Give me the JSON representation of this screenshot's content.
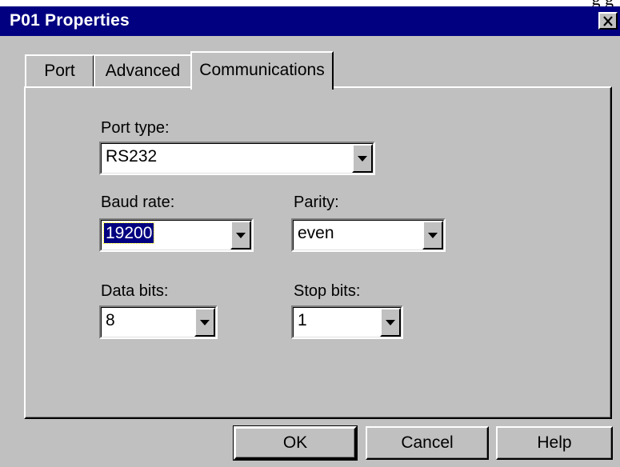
{
  "background_text": "g g",
  "window": {
    "title": "P01 Properties",
    "colors": {
      "titlebar": "#000080",
      "face": "#c0c0c0",
      "selection": "#000080"
    }
  },
  "tabs": [
    {
      "label": "Port",
      "active": false
    },
    {
      "label": "Advanced",
      "active": false
    },
    {
      "label": "Communications",
      "active": true
    }
  ],
  "communications": {
    "port_type": {
      "label": "Port type:",
      "value": "RS232"
    },
    "baud_rate": {
      "label": "Baud rate:",
      "value": "19200"
    },
    "parity": {
      "label": "Parity:",
      "value": "even"
    },
    "data_bits": {
      "label": "Data bits:",
      "value": "8"
    },
    "stop_bits": {
      "label": "Stop bits:",
      "value": "1"
    }
  },
  "buttons": {
    "ok": "OK",
    "cancel": "Cancel",
    "help": "Help"
  },
  "icons": {
    "close": "close-icon",
    "dropdown": "dropdown-arrow-icon"
  }
}
